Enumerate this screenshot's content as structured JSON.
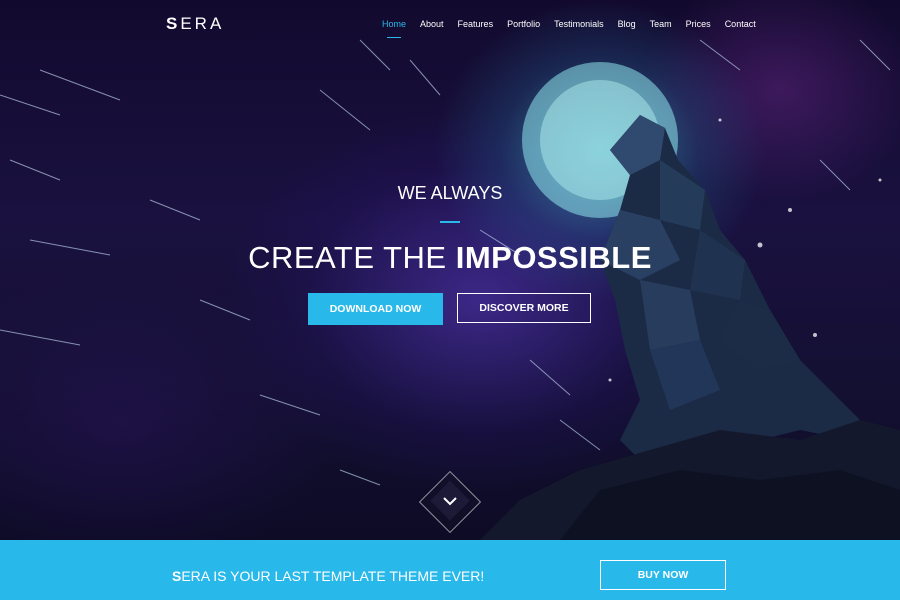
{
  "brand": {
    "logo_first": "S",
    "logo_rest": "ERA"
  },
  "nav": {
    "items": [
      {
        "label": "Home",
        "active": true
      },
      {
        "label": "About",
        "active": false
      },
      {
        "label": "Features",
        "active": false
      },
      {
        "label": "Portfolio",
        "active": false
      },
      {
        "label": "Testimonials",
        "active": false
      },
      {
        "label": "Blog",
        "active": false
      },
      {
        "label": "Team",
        "active": false
      },
      {
        "label": "Prices",
        "active": false
      },
      {
        "label": "Contact",
        "active": false
      }
    ]
  },
  "hero": {
    "kicker": "WE ALWAYS",
    "headline_regular": "CREATE THE ",
    "headline_bold": "IMPOSSIBLE",
    "primary_button": "DOWNLOAD NOW",
    "secondary_button": "DISCOVER MORE",
    "scroll_icon": "chevron-down-icon"
  },
  "cta": {
    "text_first": "S",
    "text_rest": "ERA IS YOUR LAST TEMPLATE THEME EVER!",
    "button": "BUY NOW"
  },
  "colors": {
    "accent": "#29b8ea",
    "background": "#120a2e",
    "text": "#ffffff"
  }
}
